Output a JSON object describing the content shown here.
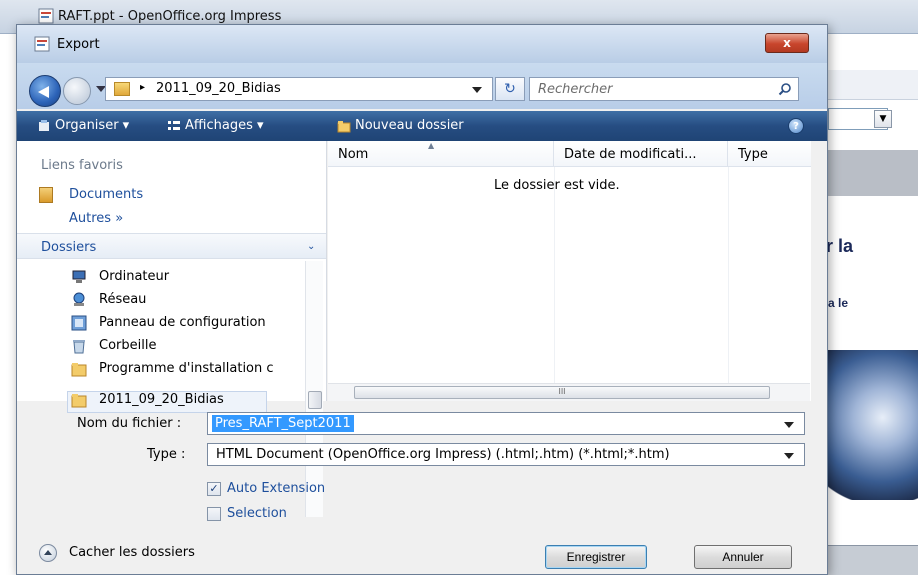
{
  "app": {
    "title": "RAFT.ppt - OpenOffice.org Impress",
    "slide_text_1": "r la",
    "slide_text_2": "a le",
    "toolbar_dropdown_arrow": "▼"
  },
  "dialog": {
    "title": "Export",
    "close_label": "x",
    "address": {
      "path": "2011_09_20_Bidias",
      "separator": "▸",
      "refresh_label": "↻"
    },
    "search": {
      "placeholder": "Rechercher"
    },
    "commands": {
      "organise": "Organiser ▾",
      "views": "Affichages ▾",
      "new_folder": "Nouveau dossier",
      "help": "?"
    },
    "favorites": {
      "header": "Liens favoris",
      "items": [
        "Documents"
      ],
      "more": "Autres  »"
    },
    "folders": {
      "header": "Dossiers",
      "chevron": "⌄",
      "items": [
        "Ordinateur",
        "Réseau",
        "Panneau de configuration",
        "Corbeille",
        "Programme d'installation c",
        "2011_09_20_Bidias"
      ],
      "selected": "2011_09_20_Bidias"
    },
    "list": {
      "columns": [
        "Nom",
        "Date de modificati...",
        "Type"
      ],
      "empty_message": "Le dossier est vide.",
      "scroll_grip": "III"
    },
    "form": {
      "filename_label": "Nom du fichier :",
      "filename_value": "Pres_RAFT_Sept2011",
      "type_label": "Type :",
      "type_value": "HTML Document (OpenOffice.org Impress) (.html;.htm) (*.html;*.htm)",
      "auto_extension_label": "Auto Extension",
      "auto_extension_checked": true,
      "selection_label": "Selection",
      "selection_checked": false,
      "check_mark": "✓"
    },
    "footer": {
      "hide_folders": "Cacher les dossiers",
      "save_button": "Enregistrer",
      "cancel_button": "Annuler"
    }
  },
  "colors": {
    "accent": "#2f5fae",
    "link": "#1e4f9c",
    "selection": "#3399ff",
    "command_bar": "#264d82"
  }
}
